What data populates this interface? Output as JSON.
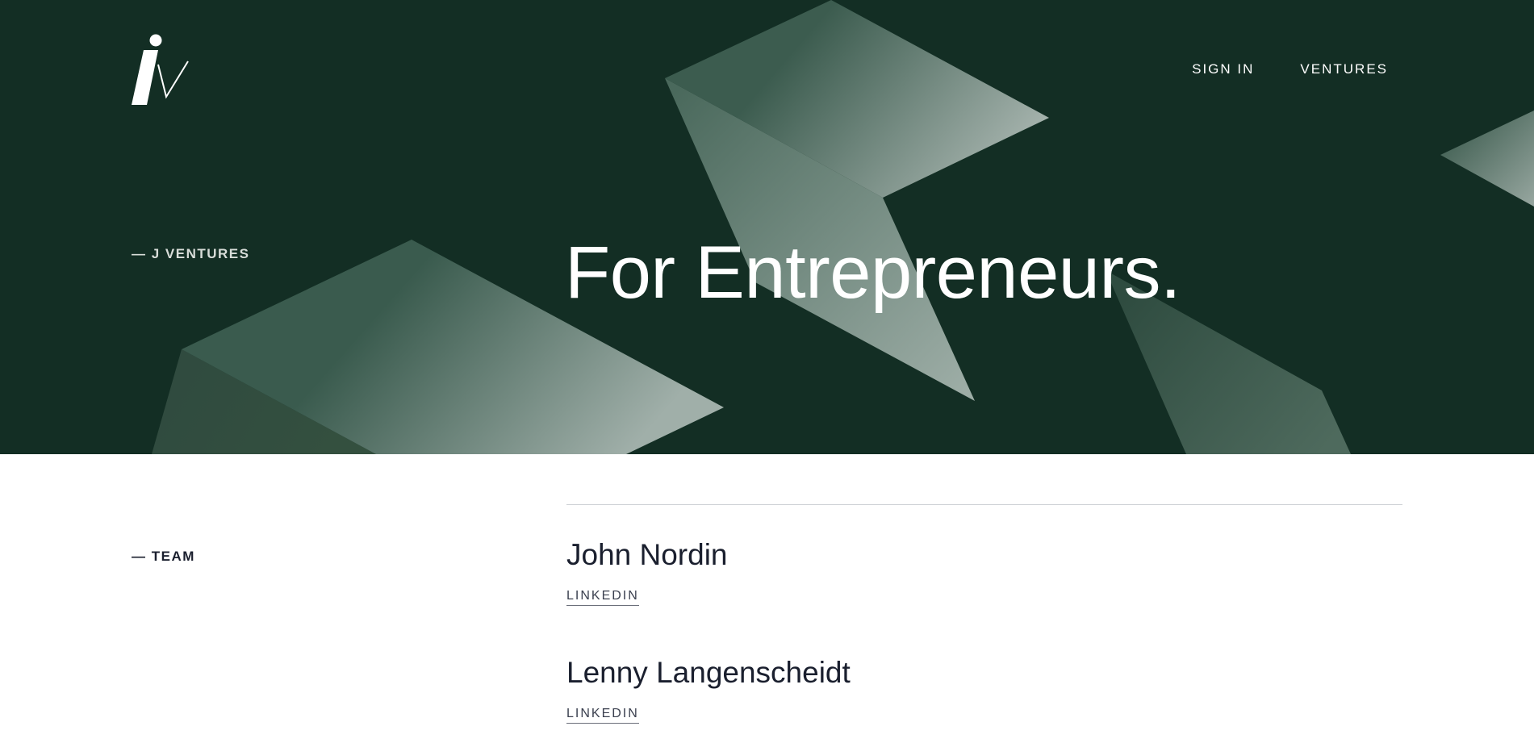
{
  "header": {
    "nav": [
      {
        "label": "SIGN IN"
      },
      {
        "label": "VENTURES"
      }
    ]
  },
  "hero": {
    "label": "— J VENTURES",
    "title": "For Entrepreneurs."
  },
  "team": {
    "label": "— TEAM",
    "members": [
      {
        "name": "John Nordin",
        "link_label": "LINKEDIN"
      },
      {
        "name": "Lenny Langenscheidt",
        "link_label": "LINKEDIN"
      }
    ]
  },
  "colors": {
    "hero_background": "#132e24",
    "text_dark": "#1a1f2e",
    "divider": "#cfd2d6"
  },
  "icons": {
    "logo": "jv-monogram-logo"
  }
}
